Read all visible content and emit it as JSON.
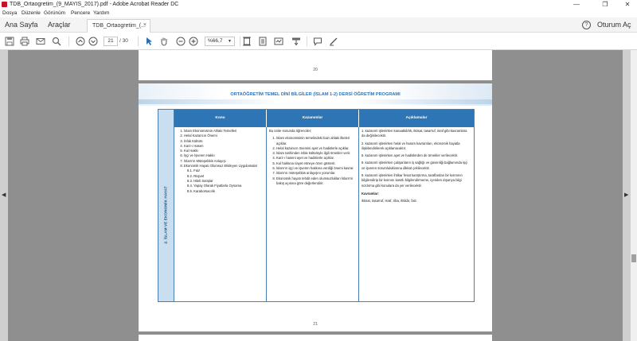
{
  "window": {
    "title": "TDB_Ortaogretim_(9_MAYIS_2017).pdf - Adobe Acrobat Reader DC",
    "minimize": "—",
    "maximize": "❐",
    "close": "✕"
  },
  "menu": {
    "items": [
      "Dosya",
      "Düzenle",
      "Görünüm",
      "Pencere",
      "Yardım"
    ]
  },
  "tabs": {
    "home": "Ana Sayfa",
    "tools": "Araçlar",
    "document": "TDB_Ortaogretim_(...",
    "close": "×",
    "help": "?",
    "login": "Oturum Aç"
  },
  "toolbar": {
    "page_current": "21",
    "page_total": "/ 30",
    "zoom": "%66,7",
    "icons": [
      "save-icon",
      "print-icon",
      "email-icon",
      "search-icon",
      "page-up-icon",
      "page-down-icon",
      "select-cursor-icon",
      "hand-icon",
      "zoom-out-icon",
      "zoom-in-icon",
      "fit-page-icon",
      "scroll-mode-icon",
      "read-mode-icon",
      "marquee-icon",
      "comment-icon",
      "sign-icon"
    ]
  },
  "document": {
    "page_prev_number": "20",
    "page_number": "21",
    "title": "ORTAÖĞRETİM TEMEL DİNİ BİLGİLER (İSLAM 1-2) DERSİ ÖĞRETİM PROGRAMI",
    "vertical_label": "2. İSLAM VE EKONOMİK HAYAT",
    "headers": [
      "Konu",
      "Kazanımlar",
      "Açıklamalar"
    ],
    "konu": [
      "İslam Ekonomisinin Ahlaki Temelleri",
      "Helal Kazancın Önemi",
      "İnfak Kültürü",
      "Karz-ı Hasen",
      "Kul Hakkı",
      "İşçi ve İşveren Hakkı",
      "İslam'ın Müteşebbis Anlayışı",
      "Ekonomik Hayatı Olumsuz Etkileyen Uygulamalar",
      "8.1. Faiz",
      "8.2. Rüşvet",
      "8.3. Hileli Satışlar",
      "8.4. Yapay Olarak Fiyatlarla Oynama",
      "8.5. Karaborsacılık"
    ],
    "kazanimlar_intro": "Bu ünite sonunda öğrenciler;",
    "kazanimlar": [
      "İslam ekonomisinin temelindeki bazı ahlaki ilkeleri açıklar.",
      "Helal kazancın önemini ayet ve hadislerle açıklar.",
      "İslam tarihinden infak kültürüyle ilgili örnekler verir.",
      "Karz-ı haseni ayet ve hadislerle açıklar.",
      "Kul hakkına riayet etmeye özen gösterir.",
      "İslam'ın işçi ve işveren hakkına verdiği önemi kavrar.",
      "İslam'ın müteşebbis anlayışını yorumlar.",
      "Ekonomik hayatı tehdit eden olumsuzlukları İslam'ın bakış açısına göre değerlendirir."
    ],
    "aciklamalar": [
      "1. kazanım işlenirken kanaatkârlık, iktisat, tasarruf, israf gibi kavramlara da değinilecektir.",
      "2. kazanım işlenirken helal ve haram kavramları, ekonomik hayatla ilişkilendirilerek açıklanacaktır.",
      "5. kazanım işlenirken ayet ve hadislerden de örnekler verilecektir.",
      "6. kazanım işlenirken çalışanların iş sağlığı ve güvenliği bağlamında işçi ve işveren sorumluluklarına dikkat çekilecektir.",
      "8. kazanım işlenirken ihtikar fesat karıştırma, taraflardan bir kısmının bilgilendirip bir kısmını kasıtlı bilgilendirmeme, içeriden dışarıya bilgi sızdırma gibi konulara da yer verilecektir."
    ],
    "kavramlar_label": "Kavramlar:",
    "kavramlar": "iktisat, tasarruf, israf, riba, ihtikâr, faiz."
  }
}
